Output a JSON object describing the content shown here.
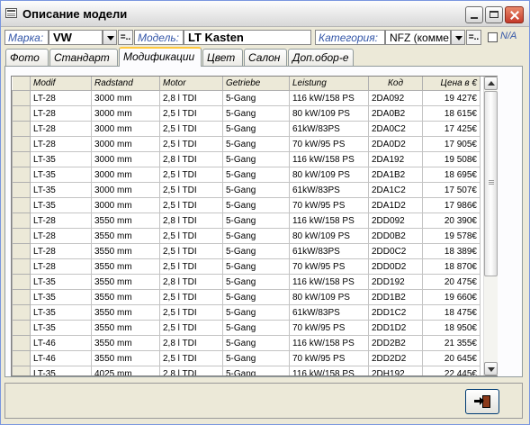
{
  "window": {
    "title": "Описание модели"
  },
  "filters": {
    "make_label": "Марка:",
    "make_value": "VW",
    "model_label": "Модель:",
    "model_value": "LT Kasten",
    "category_label": "Категория:",
    "category_value": "NFZ (комме",
    "na_label": "N/A",
    "filter_button_label": "=.."
  },
  "tabs": [
    {
      "label": "Фото"
    },
    {
      "label": "Стандарт"
    },
    {
      "label": "Модификации",
      "active": true
    },
    {
      "label": "Цвет"
    },
    {
      "label": "Салон"
    },
    {
      "label": "Доп.обор-е"
    }
  ],
  "table": {
    "columns": [
      "Modif",
      "Radstand",
      "Motor",
      "Getriebe",
      "Leistung",
      "Код",
      "Цена в €"
    ],
    "rows": [
      [
        "LT-28",
        "3000 mm",
        "2,8 l TDI",
        "5-Gang",
        "116 kW/158 PS",
        "2DA092",
        "19 427€"
      ],
      [
        "LT-28",
        "3000 mm",
        "2,5 l TDI",
        "5-Gang",
        "80 kW/109 PS",
        "2DA0B2",
        "18 615€"
      ],
      [
        "LT-28",
        "3000 mm",
        "2,5 l TDI",
        "5-Gang",
        "61kW/83PS",
        "2DA0C2",
        "17 425€"
      ],
      [
        "LT-28",
        "3000 mm",
        "2,5 l TDI",
        "5-Gang",
        "70 kW/95 PS",
        "2DA0D2",
        "17 905€"
      ],
      [
        "LT-35",
        "3000 mm",
        "2,8 l TDI",
        "5-Gang",
        "116 kW/158 PS",
        "2DA192",
        "19 508€"
      ],
      [
        "LT-35",
        "3000 mm",
        "2,5 l TDI",
        "5-Gang",
        "80 kW/109 PS",
        "2DA1B2",
        "18 695€"
      ],
      [
        "LT-35",
        "3000 mm",
        "2,5 l TDI",
        "5-Gang",
        "61kW/83PS",
        "2DA1C2",
        "17 507€"
      ],
      [
        "LT-35",
        "3000 mm",
        "2,5 l TDI",
        "5-Gang",
        "70 kW/95 PS",
        "2DA1D2",
        "17 986€"
      ],
      [
        "LT-28",
        "3550 mm",
        "2,8 l TDI",
        "5-Gang",
        "116 kW/158 PS",
        "2DD092",
        "20 390€"
      ],
      [
        "LT-28",
        "3550 mm",
        "2,5 l TDI",
        "5-Gang",
        "80 kW/109 PS",
        "2DD0B2",
        "19 578€"
      ],
      [
        "LT-28",
        "3550 mm",
        "2,5 l TDI",
        "5-Gang",
        "61kW/83PS",
        "2DD0C2",
        "18 389€"
      ],
      [
        "LT-28",
        "3550 mm",
        "2,5 l TDI",
        "5-Gang",
        "70 kW/95 PS",
        "2DD0D2",
        "18 870€"
      ],
      [
        "LT-35",
        "3550 mm",
        "2,8 l TDI",
        "5-Gang",
        "116 kW/158 PS",
        "2DD192",
        "20 475€"
      ],
      [
        "LT-35",
        "3550 mm",
        "2,5 l TDI",
        "5-Gang",
        "80 kW/109 PS",
        "2DD1B2",
        "19 660€"
      ],
      [
        "LT-35",
        "3550 mm",
        "2,5 l TDI",
        "5-Gang",
        "61kW/83PS",
        "2DD1C2",
        "18 475€"
      ],
      [
        "LT-35",
        "3550 mm",
        "2,5 l TDI",
        "5-Gang",
        "70 kW/95 PS",
        "2DD1D2",
        "18 950€"
      ],
      [
        "LT-46",
        "3550 mm",
        "2,8 l TDI",
        "5-Gang",
        "116 kW/158 PS",
        "2DD2B2",
        "21 355€"
      ],
      [
        "LT-46",
        "3550 mm",
        "2,5 l TDI",
        "5-Gang",
        "70 kW/95 PS",
        "2DD2D2",
        "20 645€"
      ],
      [
        "LT-35",
        "4025 mm",
        "2,8 l TDI",
        "5-Gang",
        "116 kW/158 PS",
        "2DH192",
        "22 445€"
      ]
    ]
  },
  "icons": {
    "app": "form-icon",
    "exit": "exit-door-icon"
  }
}
